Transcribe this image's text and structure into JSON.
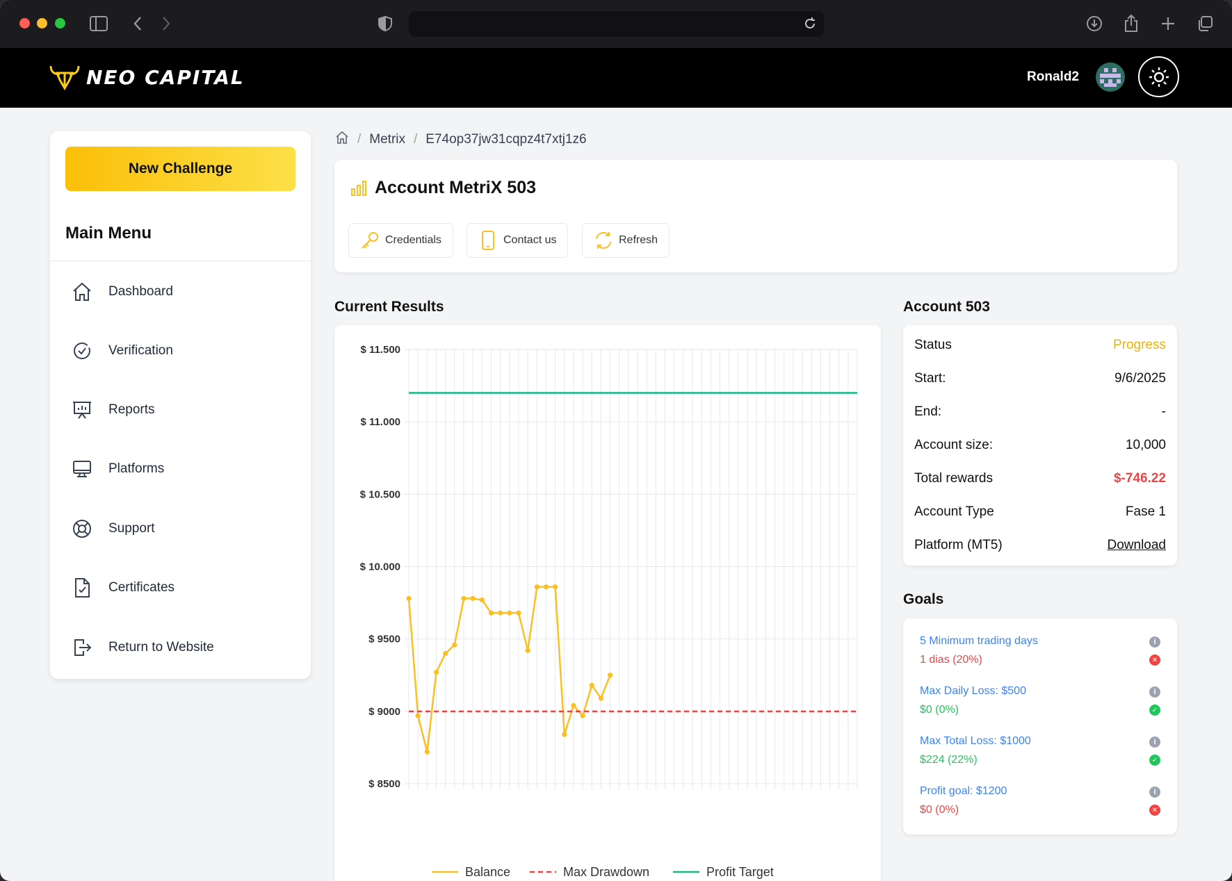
{
  "app": {
    "brand": "NEO CAPITAL",
    "username": "Ronald2"
  },
  "sidebar": {
    "new_challenge": "New Challenge",
    "menu_title": "Main Menu",
    "items": [
      {
        "label": "Dashboard",
        "icon": "home-icon"
      },
      {
        "label": "Verification",
        "icon": "check-circle-icon"
      },
      {
        "label": "Reports",
        "icon": "presentation-chart-icon"
      },
      {
        "label": "Platforms",
        "icon": "monitor-icon"
      },
      {
        "label": "Support",
        "icon": "lifebuoy-icon"
      },
      {
        "label": "Certificates",
        "icon": "document-check-icon"
      },
      {
        "label": "Return to Website",
        "icon": "logout-icon"
      }
    ]
  },
  "breadcrumb": {
    "section": "Metrix",
    "id": "E74op37jw31cqpz4t7xtj1z6"
  },
  "account_header": {
    "title": "Account MetriX 503",
    "credentials": "Credentials",
    "contact": "Contact us",
    "refresh": "Refresh"
  },
  "sections": {
    "current_results": "Current Results",
    "account": "Account 503",
    "goals": "Goals"
  },
  "account_info": {
    "status_label": "Status",
    "status_value": "Progress",
    "start_label": "Start:",
    "start_value": "9/6/2025",
    "end_label": "End:",
    "end_value": "-",
    "size_label": "Account size:",
    "size_value": "10,000",
    "rewards_label": "Total rewards",
    "rewards_value": "$-746.22",
    "type_label": "Account Type",
    "type_value": "Fase 1",
    "platform_label": "Platform (MT5)",
    "platform_value": "Download"
  },
  "goals": [
    {
      "name": "5 Minimum trading days",
      "value": "1 dias (20%)",
      "status": "fail"
    },
    {
      "name": "Max Daily Loss: $500",
      "value": "$0 (0%)",
      "status": "ok"
    },
    {
      "name": "Max Total Loss: $1000",
      "value": "$224 (22%)",
      "status": "ok"
    },
    {
      "name": "Profit goal: $1200",
      "value": "$0 (0%)",
      "status": "fail"
    }
  ],
  "colors": {
    "accent": "#fbbf24",
    "profit_target": "#10b981",
    "max_drawdown": "#ef4444",
    "balance": "#fbbf24"
  },
  "chart_data": {
    "type": "line",
    "title": "",
    "xlabel": "",
    "ylabel": "",
    "ylim": [
      8500,
      11500
    ],
    "yticks": [
      "$ 11.500",
      "$ 11.000",
      "$ 10.500",
      "$ 10.000",
      "$ 9500",
      "$ 9000",
      "$ 8500"
    ],
    "grid": true,
    "legend": "bottom",
    "x_count": 50,
    "series": [
      {
        "name": "Balance",
        "style": "solid",
        "values": [
          9780,
          8970,
          8720,
          9270,
          9400,
          9460,
          9780,
          9780,
          9770,
          9680,
          9680,
          9680,
          9680,
          9420,
          9860,
          9860,
          9860,
          8840,
          9040,
          8970,
          9180,
          9090,
          9250
        ]
      },
      {
        "name": "Max Drawdown",
        "style": "dashed",
        "constant": 9000
      },
      {
        "name": "Profit Target",
        "style": "solid",
        "constant": 11200
      }
    ]
  }
}
